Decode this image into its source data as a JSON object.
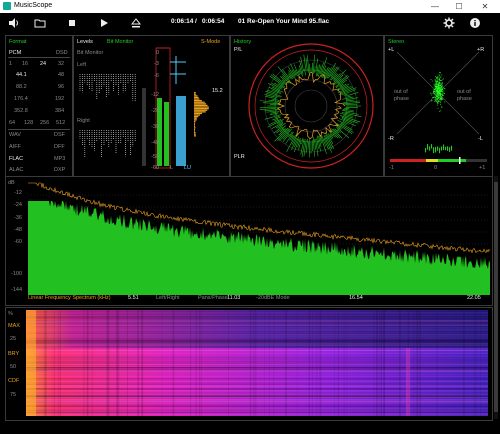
{
  "window": {
    "title": "MusicScope",
    "minimize": "—",
    "maximize": "☐",
    "close": "✕"
  },
  "toolbar": {
    "volume_icon": "speaker-icon",
    "open_icon": "folder-icon",
    "stop_icon": "stop-icon",
    "play_icon": "play-icon",
    "eject_icon": "eject-icon",
    "current_time": "0:06:14",
    "separator": "/",
    "total_time": "0:06:54",
    "track": "01 Re-Open Your Mind 95.flac",
    "settings_icon": "gear-icon",
    "info_icon": "info-icon"
  },
  "format": {
    "title": "Format",
    "pcm": "PCM",
    "dsd": "DSD",
    "bits": [
      "1",
      "16",
      "24",
      "32"
    ],
    "rates": [
      [
        "44.1",
        "48"
      ],
      [
        "88.2",
        "96"
      ],
      [
        "176.4",
        "192"
      ],
      [
        "352.8",
        "384"
      ]
    ],
    "dsd_rates": [
      "64",
      "128",
      "256",
      "512"
    ],
    "containers": [
      [
        "WAV",
        "DSF"
      ],
      [
        "AIFF",
        "DFF"
      ],
      [
        "FLAC",
        "MP3"
      ],
      [
        "ALAC",
        "DXP"
      ]
    ]
  },
  "levels": {
    "title": "Levels",
    "bit_monitor_tab": "Bit Monitor",
    "bit_monitor_label": "Bit Monitor",
    "left": "Left",
    "right": "Right",
    "smode": "S-Mode",
    "scale": [
      "0",
      "-3",
      "-6",
      "-12",
      "-20",
      "-30",
      "-40",
      "-50",
      "-60"
    ],
    "channel_left": "L",
    "channel_right": "LU",
    "peak_value": "15.2"
  },
  "history": {
    "title": "History",
    "pl": "P/L",
    "plr": "PLR"
  },
  "stereo": {
    "title": "Stereo",
    "plus_l": "+L",
    "plus_r": "+R",
    "minus_r": "-R",
    "minus_l": "-L",
    "out_of_phase_1": "out of",
    "out_of_phase_2": "phase",
    "corr_min": "-1",
    "corr_mid": "0",
    "corr_max": "+1"
  },
  "spectrum": {
    "db_label": "dB",
    "yticks": [
      "-12",
      "-24",
      "-36",
      "-48",
      "-60",
      "-100",
      "-144"
    ],
    "xlabel": "Linear Frequency Spectrum (kHz)",
    "xticks": [
      "5.51",
      "11.03",
      "16.54",
      "22.05"
    ],
    "modes": [
      "Left/Right",
      "Pans/Phase",
      "-20dBE Mode"
    ]
  },
  "spectrogram": {
    "labels": [
      "%",
      "MAX",
      "25",
      "BRY",
      "50",
      "CDF",
      "75"
    ]
  }
}
